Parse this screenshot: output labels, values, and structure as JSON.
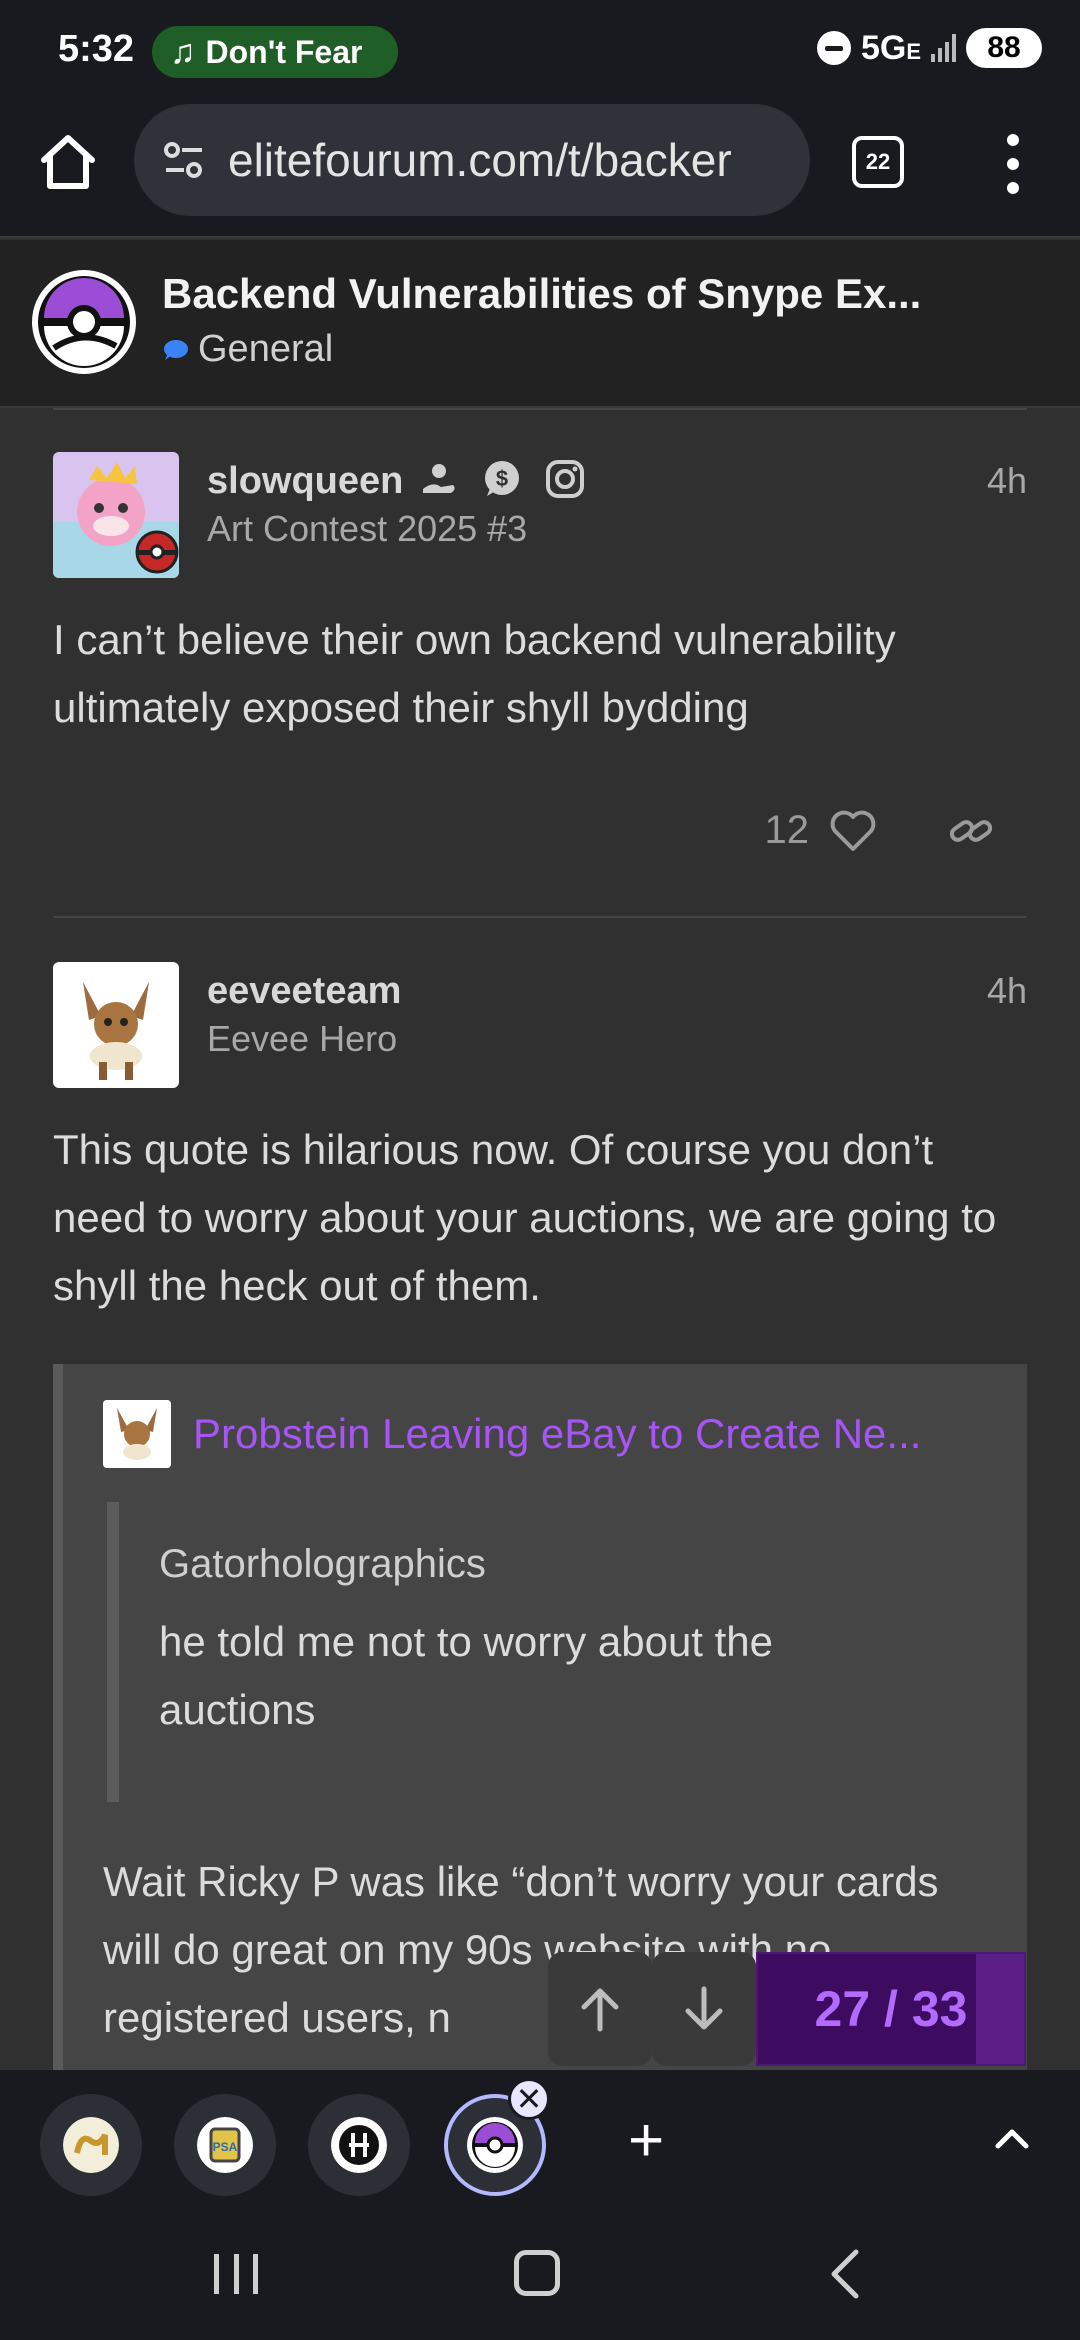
{
  "status_bar": {
    "time": "5:32",
    "media_label": "Don't Fear",
    "network": "5G",
    "network_suffix": "E",
    "battery": "88"
  },
  "browser": {
    "url": "elitefourum.com/t/backer",
    "tab_count": "22"
  },
  "topic": {
    "title": "Backend Vulnerabilities of Snype Ex...",
    "category": "General",
    "category_color": "#3b82f6"
  },
  "posts": [
    {
      "username": "slowqueen",
      "user_title": "Art Contest 2025 #3",
      "time": "4h",
      "body": "I can’t believe their own backend vulnerability ultimately exposed their shyll bydding",
      "likes": "12"
    },
    {
      "username": "eeveeteam",
      "user_title": "Eevee Hero",
      "time": "4h",
      "body": "This quote is hilarious now. Of course you don’t need to worry about your auctions, we are going to shyll the heck out of them."
    }
  ],
  "quote": {
    "link_title": "Probstein Leaving eBay to Create Ne...",
    "inner_author": "Gatorholographics",
    "inner_text": "he told me not to worry about the auctions",
    "body": "Wait Ricky P was like “don’t worry your cards will do great on my 90s website with no registered users, n"
  },
  "timeline": {
    "current": 27,
    "total": 33,
    "label": "27 / 33"
  },
  "colors": {
    "accent": "#a855f7",
    "timeline_bg": "#5b1e87"
  }
}
